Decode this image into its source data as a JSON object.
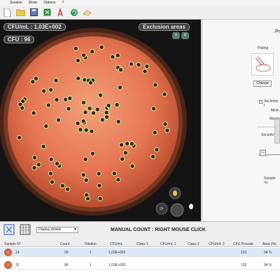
{
  "menu": [
    "Session",
    "Mode",
    "Options",
    "?"
  ],
  "toolbar": {
    "icons": [
      "new-file-icon",
      "open-folder-icon",
      "save-icon",
      "excel-export-icon",
      "pdf-icon",
      "refresh-icon",
      "eraser-icon"
    ]
  },
  "viewer": {
    "cfu_text": "CFU/mL : 1,03E+002",
    "count_text": "CFU : 96",
    "exclusion_label": "Exclusion areas",
    "exclusion_icons": [
      "add-exclusion-icon",
      "remove-exclusion-icon"
    ],
    "colors": {
      "agar": "#e67553",
      "rim": "#7a3a22",
      "colony_ring": "#d6e38a",
      "colony_center": "#3a2418",
      "background": "#141414"
    },
    "colonies": 96
  },
  "right_panel": {
    "title": "Pr",
    "plating_label": "Plating",
    "change_label": "Change",
    "set_limits_label": "Set limits t",
    "min_label": "Minin",
    "max_label": "Maxim",
    "sensitivity_label": "Sensitivity",
    "slider_value": "—",
    "sample_num_label": "Sample nu"
  },
  "bottom": {
    "display_select": "Display details",
    "manual_title": "MANUAL COUNT : RIGHT MOUSE CLICK"
  },
  "table": {
    "columns": [
      "Sample N°",
      "Count",
      "Dilution",
      "CFU/mL",
      "Class 1",
      "CFU/mL 1",
      "Class 2",
      "CFU/mL 2",
      "CFU Provate",
      "Area (%)"
    ],
    "rows": [
      {
        "sample": "14",
        "count": "96",
        "dilution": "1",
        "cfu_ml": "1,03E+002",
        "class1": "",
        "cfu1": "",
        "class2": "",
        "cfu2": "",
        "provate": "103",
        "area": "94 %"
      },
      {
        "sample": "15",
        "count": "96",
        "dilution": "1",
        "cfu_ml": "1,03E+002",
        "class1": "",
        "cfu1": "",
        "class2": "",
        "cfu2": "",
        "provate": "103",
        "area": "94 %"
      }
    ]
  }
}
